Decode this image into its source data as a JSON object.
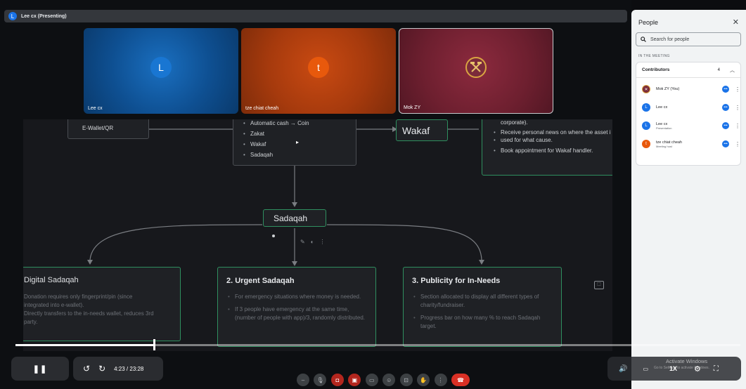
{
  "presenter": {
    "initial": "L",
    "label": "Lee cx (Presenting)"
  },
  "tiles": [
    {
      "name": "Lee cx",
      "initial": "L"
    },
    {
      "name": "tze chiat cheah",
      "initial": "t"
    },
    {
      "name": "Mok ZY"
    }
  ],
  "slide": {
    "ewallet": "E-Wallet/QR",
    "center_items": [
      "Automatic cash → Coin",
      "Zakat",
      "Wakaf",
      "Sadaqah"
    ],
    "wakaf": "Wakaf",
    "wakaf_items": [
      "corporate).",
      "Receive personal news on where the asset i",
      "used for what cause.",
      "Book appointment for Wakaf handler."
    ],
    "sadaqah": "Sadaqah",
    "digital": {
      "title": "Digital Sadaqah",
      "lines": [
        "Donation requires only fingerprint/pin (since",
        "integrated into e-wallet).",
        "Directly transfers to the in-needs wallet, reduces 3rd",
        "party."
      ]
    },
    "urgent": {
      "title": "2. Urgent Sadaqah",
      "items": [
        "For emergency situations where money is needed.",
        "If 3 people have emergency at the same time, (number of people with app)/3, randomly distributed."
      ]
    },
    "publicity": {
      "title": "3. Publicity for In-Needs",
      "items": [
        "Section allocated to display all different types of charity/fundraiser.",
        "Progress bar on how many % to reach Sadaqah target."
      ]
    }
  },
  "panel": {
    "title": "People",
    "search_placeholder": "Search for people",
    "section_label": "IN THE MEETING",
    "contributors_label": "Contributors",
    "contributors_count": "4",
    "people": [
      {
        "name": "Mok ZY (You)",
        "role": "",
        "initial": "",
        "color": "#7b2b3a"
      },
      {
        "name": "Lee cx",
        "role": "",
        "initial": "L",
        "color": "#1a73e8"
      },
      {
        "name": "Lee cx",
        "role": "Presentation",
        "initial": "L",
        "color": "#1a73e8"
      },
      {
        "name": "tze chiat cheah",
        "role": "Meeting host",
        "initial": "t",
        "color": "#e8590c"
      }
    ]
  },
  "player": {
    "time": "4:23 / 23:28",
    "speed": "1X",
    "progress_fraction": 0.19,
    "watermark": "Activate Windows",
    "watermark_sub": "Go to Settings to activate Windows."
  }
}
